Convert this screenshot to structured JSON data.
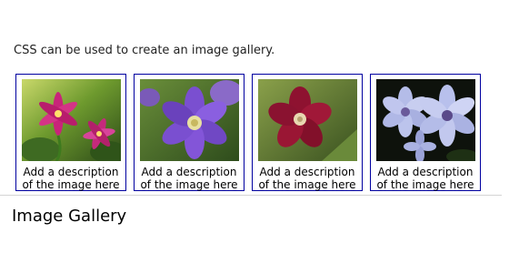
{
  "intro_text": "CSS can be used to create an image gallery.",
  "gallery": {
    "items": [
      {
        "image": "pink-lily-flower",
        "description": "Add a description of the image here"
      },
      {
        "image": "purple-clematis-flower",
        "description": "Add a description of the image here"
      },
      {
        "image": "red-clematis-flower",
        "description": "Add a description of the image here"
      },
      {
        "image": "blue-white-clematis-flowers",
        "description": "Add a description of the image here"
      }
    ],
    "border_color": "#0000a0"
  },
  "heading": "Image Gallery"
}
